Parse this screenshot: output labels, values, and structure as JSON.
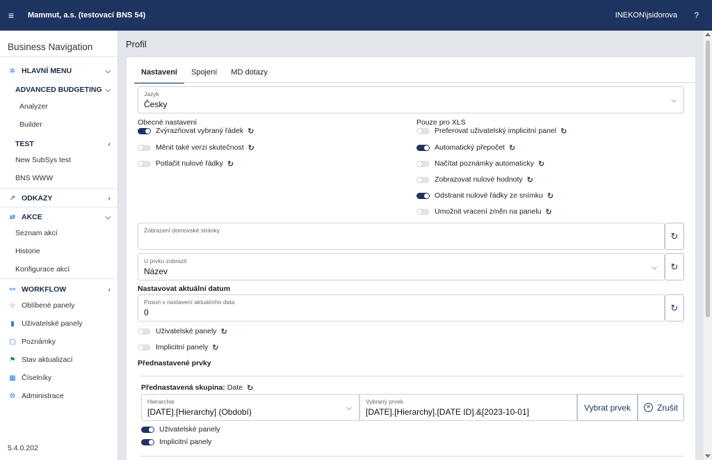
{
  "topbar": {
    "company": "Mammut, a.s. (testovací BNS 54)",
    "user": "INEKON\\jsidorova",
    "help": "?"
  },
  "sidebar": {
    "brand": "Business Navigation",
    "hlavni_menu": "HLAVNÍ MENU",
    "advanced_budgeting": "ADVANCED BUDGETING",
    "analyzer": "Analyzer",
    "builder": "Builder",
    "test": "TEST",
    "new_subsys": "New SubSys test",
    "bns_www": "BNS WWW",
    "odkazy": "ODKAZY",
    "akce": "AKCE",
    "seznam_akci": "Seznam akcí",
    "historie": "Historie",
    "konfigurace_akci": "Konfigurace akcí",
    "workflow": "WORKFLOW",
    "oblibene": "Oblíbené panely",
    "uzivatelske": "Uživatelské panely",
    "poznamky": "Poznámky",
    "stav": "Stav aktualizací",
    "ciselniky": "Číselníky",
    "administrace": "Administrace",
    "version": "5.4.0.202"
  },
  "page": {
    "title": "Profil"
  },
  "tabs": [
    "Nastavení",
    "Spojení",
    "MD dotazy"
  ],
  "jazyk": {
    "label": "Jazyk",
    "value": "Česky"
  },
  "obecne": {
    "title": "Obecné nastavení",
    "options": [
      {
        "label": "Zvýrazňovat vybraný řádek",
        "on": true
      },
      {
        "label": "Měnit také verzi skutečnost",
        "on": false
      },
      {
        "label": "Potlačit nulové řádky",
        "on": false
      }
    ]
  },
  "xls": {
    "title": "Pouze pro XLS",
    "options": [
      {
        "label": "Preferovat uživatelský implicitní panel",
        "on": false
      },
      {
        "label": "Automatický přepočet",
        "on": true
      },
      {
        "label": "Načítat poznámky automaticky",
        "on": false
      },
      {
        "label": "Zobrazovat nulové hodnoty",
        "on": false
      },
      {
        "label": "Odstranit nulové řádky ze snímku",
        "on": true
      },
      {
        "label": "Umožnit vracení změn na panelu",
        "on": false
      }
    ]
  },
  "domovska": {
    "label": "Zobrazení domovské stránky",
    "value": ""
  },
  "u_prvku": {
    "label": "U prvku zobrazit",
    "value": "Název"
  },
  "datum": {
    "title": "Nastavovat aktuální datum",
    "posun_label": "Posun v nastavení aktuálního data",
    "posun_value": "0",
    "options": [
      {
        "label": "Uživatelské panely",
        "on": false
      },
      {
        "label": "Implicitní panely",
        "on": false
      }
    ]
  },
  "prednastavene": {
    "title": "Přednastavené prvky",
    "group_label": "Přednastavená skupina:",
    "group_value": "Date",
    "hierarchie_label": "Hierarchie",
    "hierarchie_value": "[DATE].[Hierarchy] (Období)",
    "vybrany_label": "Vybraný prvek",
    "vybrany_value": "[DATE].[Hierarchy].[DATE ID].&[2023-10-01]",
    "vybrat_btn": "Vybrat prvek",
    "zrusit_btn": "Zrušit",
    "options": [
      {
        "label": "Uživatelské panely",
        "on": true
      },
      {
        "label": "Implicitní panely",
        "on": true
      }
    ]
  },
  "icons": {
    "refresh": "refresh-icon",
    "menu": "hamburger-icon",
    "accent": "#1d3461"
  }
}
